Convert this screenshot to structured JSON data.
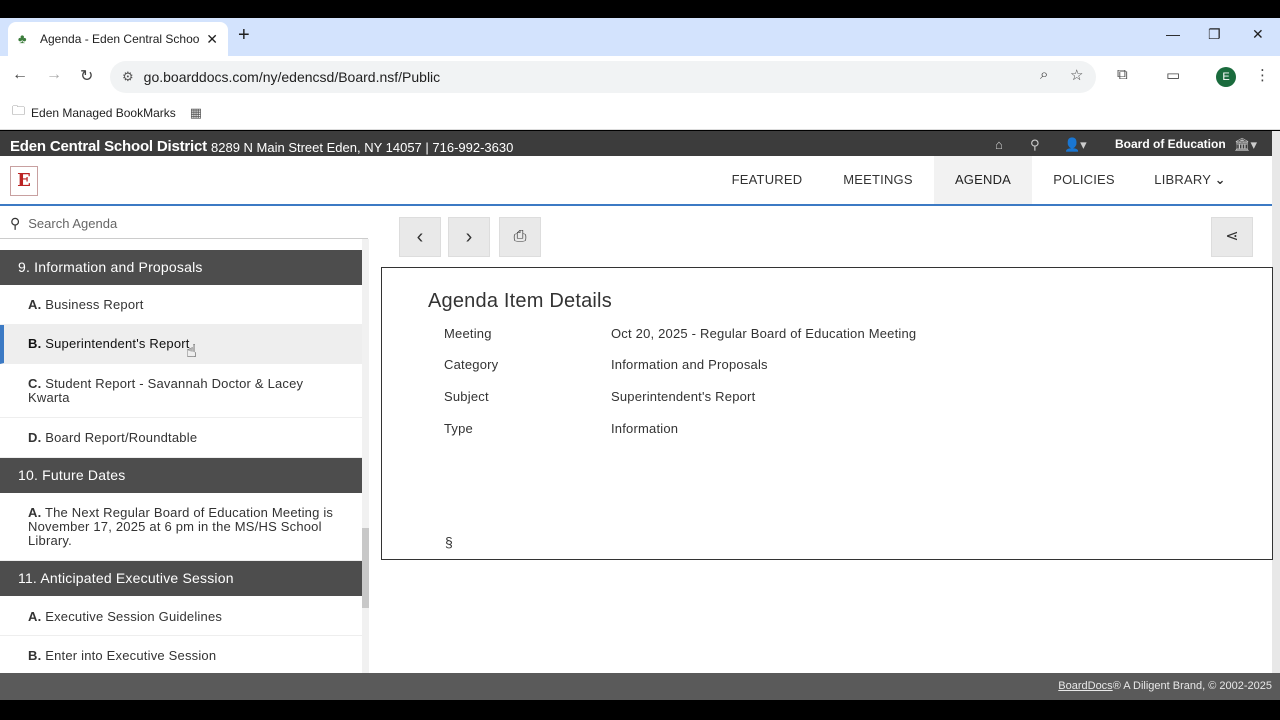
{
  "browser": {
    "tab_title": "Agenda - Eden Central School D",
    "url": "go.boarddocs.com/ny/edencsd/Board.nsf/Public",
    "bookmark_label": "Eden Managed BookMarks",
    "profile_initial": "E"
  },
  "header": {
    "district_name": "Eden Central School District",
    "address": "8289 N Main Street Eden, NY 14057 | 716-992-3630",
    "board_name": "Board of Education"
  },
  "nav": {
    "items": [
      "FEATURED",
      "MEETINGS",
      "AGENDA",
      "POLICIES",
      "LIBRARY"
    ],
    "active": "AGENDA"
  },
  "search": {
    "placeholder": "Search Agenda"
  },
  "agenda": {
    "sections": [
      {
        "title": "9. Information and Proposals",
        "items": [
          {
            "letter": "A.",
            "text": "Business Report"
          },
          {
            "letter": "B.",
            "text": "Superintendent's Report"
          },
          {
            "letter": "C.",
            "text": "Student Report - Savannah Doctor & Lacey Kwarta"
          },
          {
            "letter": "D.",
            "text": "Board Report/Roundtable"
          }
        ]
      },
      {
        "title": "10. Future Dates",
        "items": [
          {
            "letter": "A.",
            "text": "The Next Regular Board of Education Meeting is November 17, 2025 at 6 pm in the MS/HS School Library."
          }
        ]
      },
      {
        "title": "11. Anticipated Executive Session",
        "items": [
          {
            "letter": "A.",
            "text": "Executive Session Guidelines"
          },
          {
            "letter": "B.",
            "text": "Enter into Executive Session"
          }
        ]
      }
    ]
  },
  "details": {
    "heading": "Agenda Item Details",
    "rows": [
      {
        "label": "Meeting",
        "value": "Oct 20, 2025 - Regular Board of Education Meeting"
      },
      {
        "label": "Category",
        "value": "Information and Proposals"
      },
      {
        "label": "Subject",
        "value": "Superintendent's Report"
      },
      {
        "label": "Type",
        "value": "Information"
      }
    ],
    "section_mark": "§"
  },
  "footer": {
    "link": "BoardDocs",
    "text": "® A Diligent Brand, © 2002-2025"
  },
  "colors": {
    "header_bg": "#3c3c3c",
    "category_bg": "#4d4d4d",
    "accent": "#3c7ac4"
  }
}
